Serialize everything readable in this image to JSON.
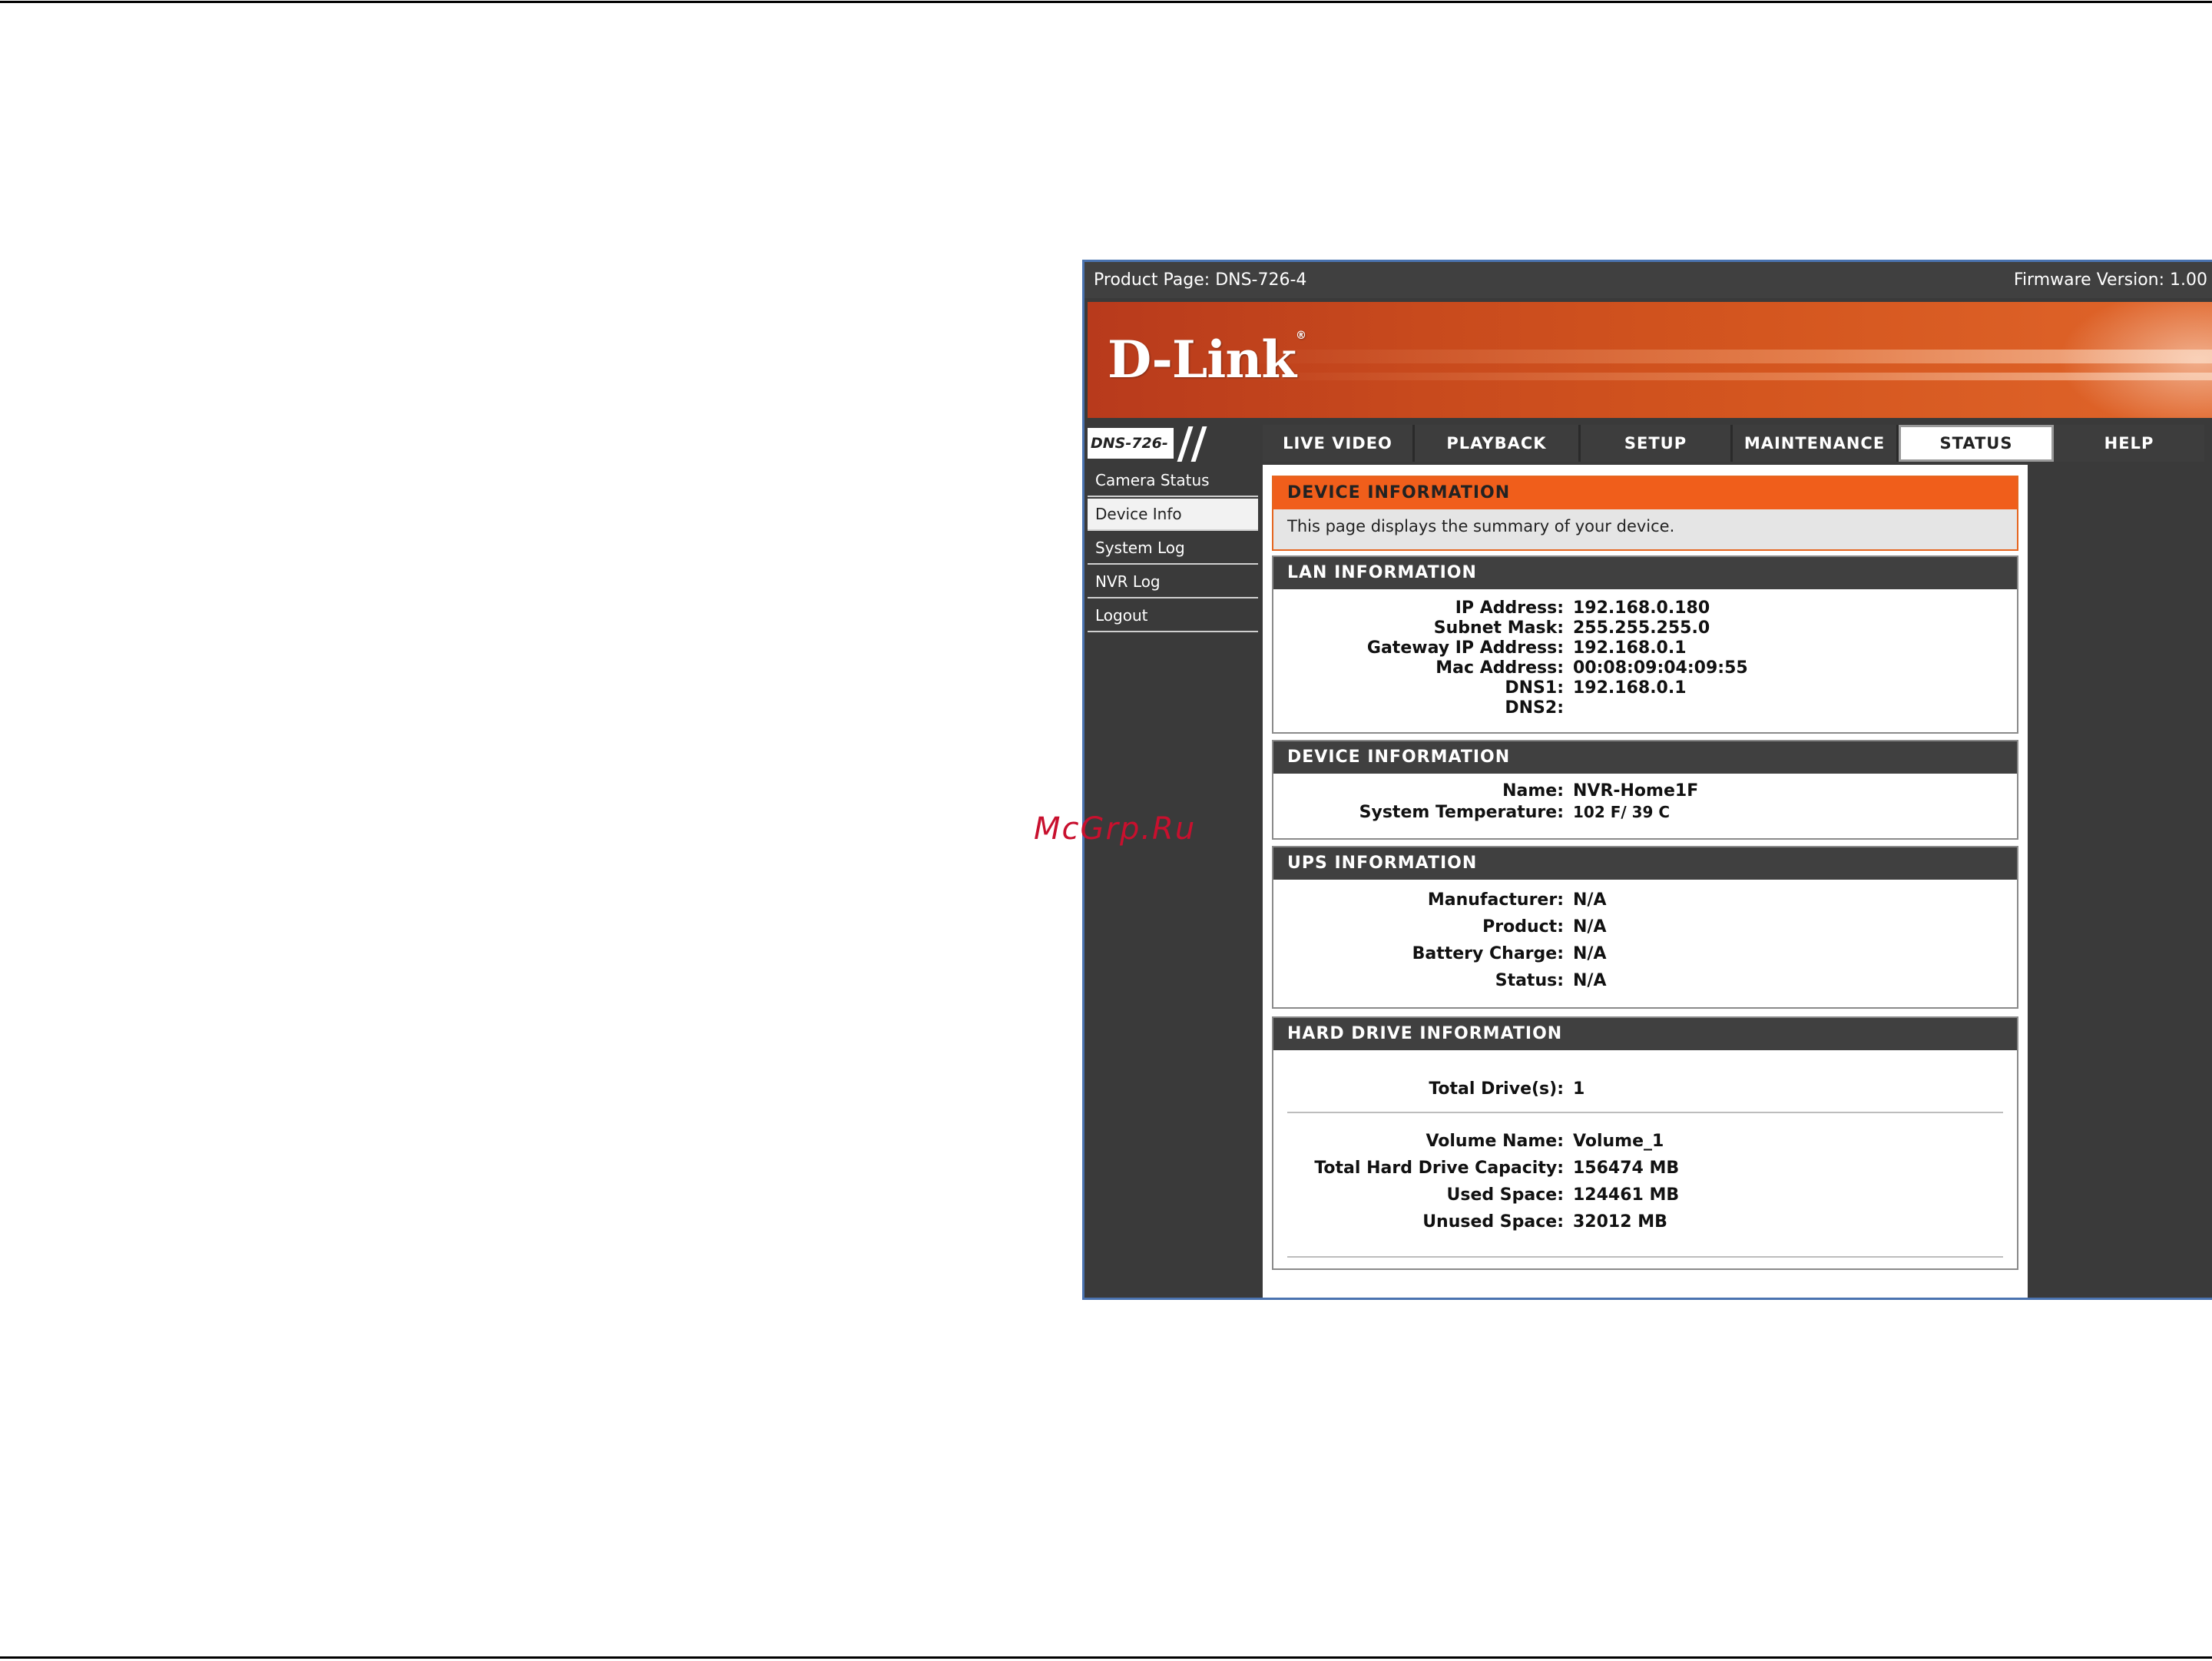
{
  "topbar": {
    "product": "Product Page: DNS-726-4",
    "firmware": "Firmware Version: 1.00"
  },
  "brand": {
    "logo": "D-Link",
    "mark": "®"
  },
  "model": "DNS-726-4",
  "tabs": [
    {
      "label": "LIVE VIDEO"
    },
    {
      "label": "PLAYBACK"
    },
    {
      "label": "SETUP"
    },
    {
      "label": "MAINTENANCE"
    },
    {
      "label": "STATUS",
      "active": true
    },
    {
      "label": "HELP"
    }
  ],
  "sidebar": {
    "items": [
      {
        "label": "Camera Status"
      },
      {
        "label": "Device Info",
        "active": true
      },
      {
        "label": "System Log"
      },
      {
        "label": "NVR Log"
      },
      {
        "label": "Logout"
      }
    ]
  },
  "intro": {
    "title": "DEVICE INFORMATION",
    "text": "This page displays the summary of your device."
  },
  "lan": {
    "title": "LAN INFORMATION",
    "rows": [
      {
        "label": "IP Address:",
        "value": "192.168.0.180"
      },
      {
        "label": "Subnet Mask:",
        "value": "255.255.255.0"
      },
      {
        "label": "Gateway IP Address:",
        "value": "192.168.0.1"
      },
      {
        "label": "Mac Address:",
        "value": "00:08:09:04:09:55"
      },
      {
        "label": "DNS1:",
        "value": "192.168.0.1"
      },
      {
        "label": "DNS2:",
        "value": ""
      }
    ]
  },
  "device": {
    "title": "DEVICE INFORMATION",
    "rows": [
      {
        "label": "Name:",
        "value": "NVR-Home1F"
      },
      {
        "label": "System Temperature:",
        "value": "102 F/ 39 C"
      }
    ]
  },
  "ups": {
    "title": "UPS INFORMATION",
    "rows": [
      {
        "label": "Manufacturer:",
        "value": "N/A"
      },
      {
        "label": "Product:",
        "value": "N/A"
      },
      {
        "label": "Battery Charge:",
        "value": "N/A"
      },
      {
        "label": "Status:",
        "value": "N/A"
      }
    ]
  },
  "hdd": {
    "title": "HARD DRIVE INFORMATION",
    "total": {
      "label": "Total Drive(s):",
      "value": "1"
    },
    "rows": [
      {
        "label": "Volume Name:",
        "value": "Volume_1"
      },
      {
        "label": "Total Hard Drive Capacity:",
        "value": "156474 MB"
      },
      {
        "label": "Used Space:",
        "value": "124461 MB"
      },
      {
        "label": "Unused Space:",
        "value": "32012 MB"
      }
    ]
  },
  "watermark": "McGrp.Ru"
}
